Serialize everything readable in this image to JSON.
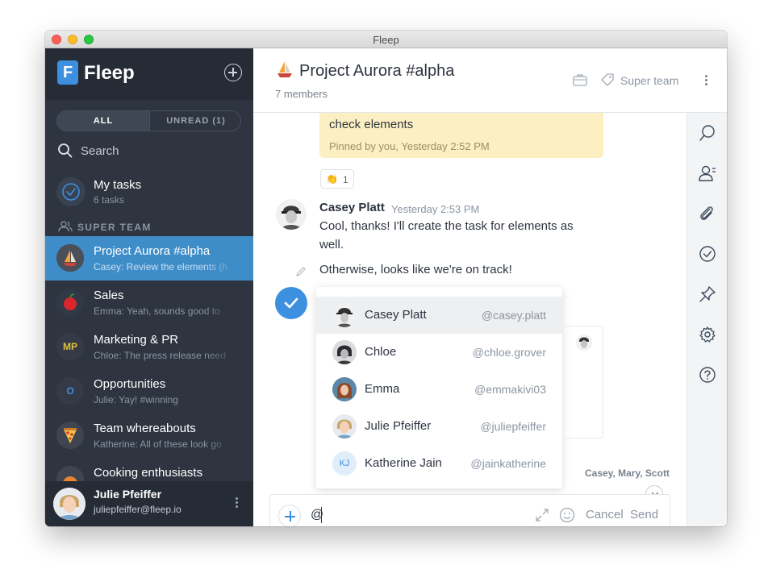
{
  "window": {
    "title": "Fleep"
  },
  "sidebar": {
    "logo_text": "Fleep",
    "logo_letter": "F",
    "filters": {
      "all": "ALL",
      "unread": "UNREAD (1)"
    },
    "search_label": "Search",
    "my_tasks": {
      "title": "My tasks",
      "subtitle": "6 tasks"
    },
    "section_label": "SUPER TEAM",
    "conversations": [
      {
        "name": "Project Aurora #alpha",
        "preview": "Casey: Review the elements (h",
        "active": true
      },
      {
        "name": "Sales",
        "preview": "Emma: Yeah, sounds good to"
      },
      {
        "name": "Marketing & PR",
        "preview": "Chloe: The press release need",
        "initials": "MP"
      },
      {
        "name": "Opportunities",
        "preview": "Julie: Yay! #winning",
        "initials": "O"
      },
      {
        "name": "Team whereabouts",
        "preview": "Katherine: All of these look go"
      },
      {
        "name": "Cooking enthusiasts",
        "preview": ""
      }
    ],
    "me": {
      "name": "Julie Pfeiffer",
      "email": "juliepfeiffer@fleep.io"
    }
  },
  "header": {
    "title": "Project Aurora #alpha",
    "members": "7 members",
    "team": "Super team"
  },
  "messages": {
    "pinned_text": "check elements",
    "pinned_meta": "Pinned by you, Yesterday 2:52 PM",
    "reaction_count": "1",
    "sender": "Casey Platt",
    "time": "Yesterday 2:53 PM",
    "text1": "Cool, thanks! I'll create the task for elements as well.",
    "text2": "Otherwise, looks like we're on track!",
    "seen_by": "Casey, Mary, Scott"
  },
  "mentions": [
    {
      "name": "Casey Platt",
      "handle": "@casey.platt",
      "selected": true
    },
    {
      "name": "Chloe",
      "handle": "@chloe.grover"
    },
    {
      "name": "Emma",
      "handle": "@emmakivi03"
    },
    {
      "name": "Julie Pfeiffer",
      "handle": "@juliepfeiffer"
    },
    {
      "name": "Katherine Jain",
      "handle": "@jainkatherine",
      "initials": "KJ"
    }
  ],
  "composer": {
    "value": "@",
    "cancel": "Cancel",
    "send": "Send"
  },
  "colors": {
    "sidebar_bg": "#2e3440",
    "active_conversation": "#3f8dc8",
    "accent_blue": "#3d8fe0",
    "pinned_bg": "#fcf0c3"
  },
  "icons": {
    "rail": [
      "search-icon",
      "members-icon",
      "paperclip-icon",
      "checkmark-icon",
      "pin-icon",
      "gear-icon",
      "help-icon"
    ]
  }
}
